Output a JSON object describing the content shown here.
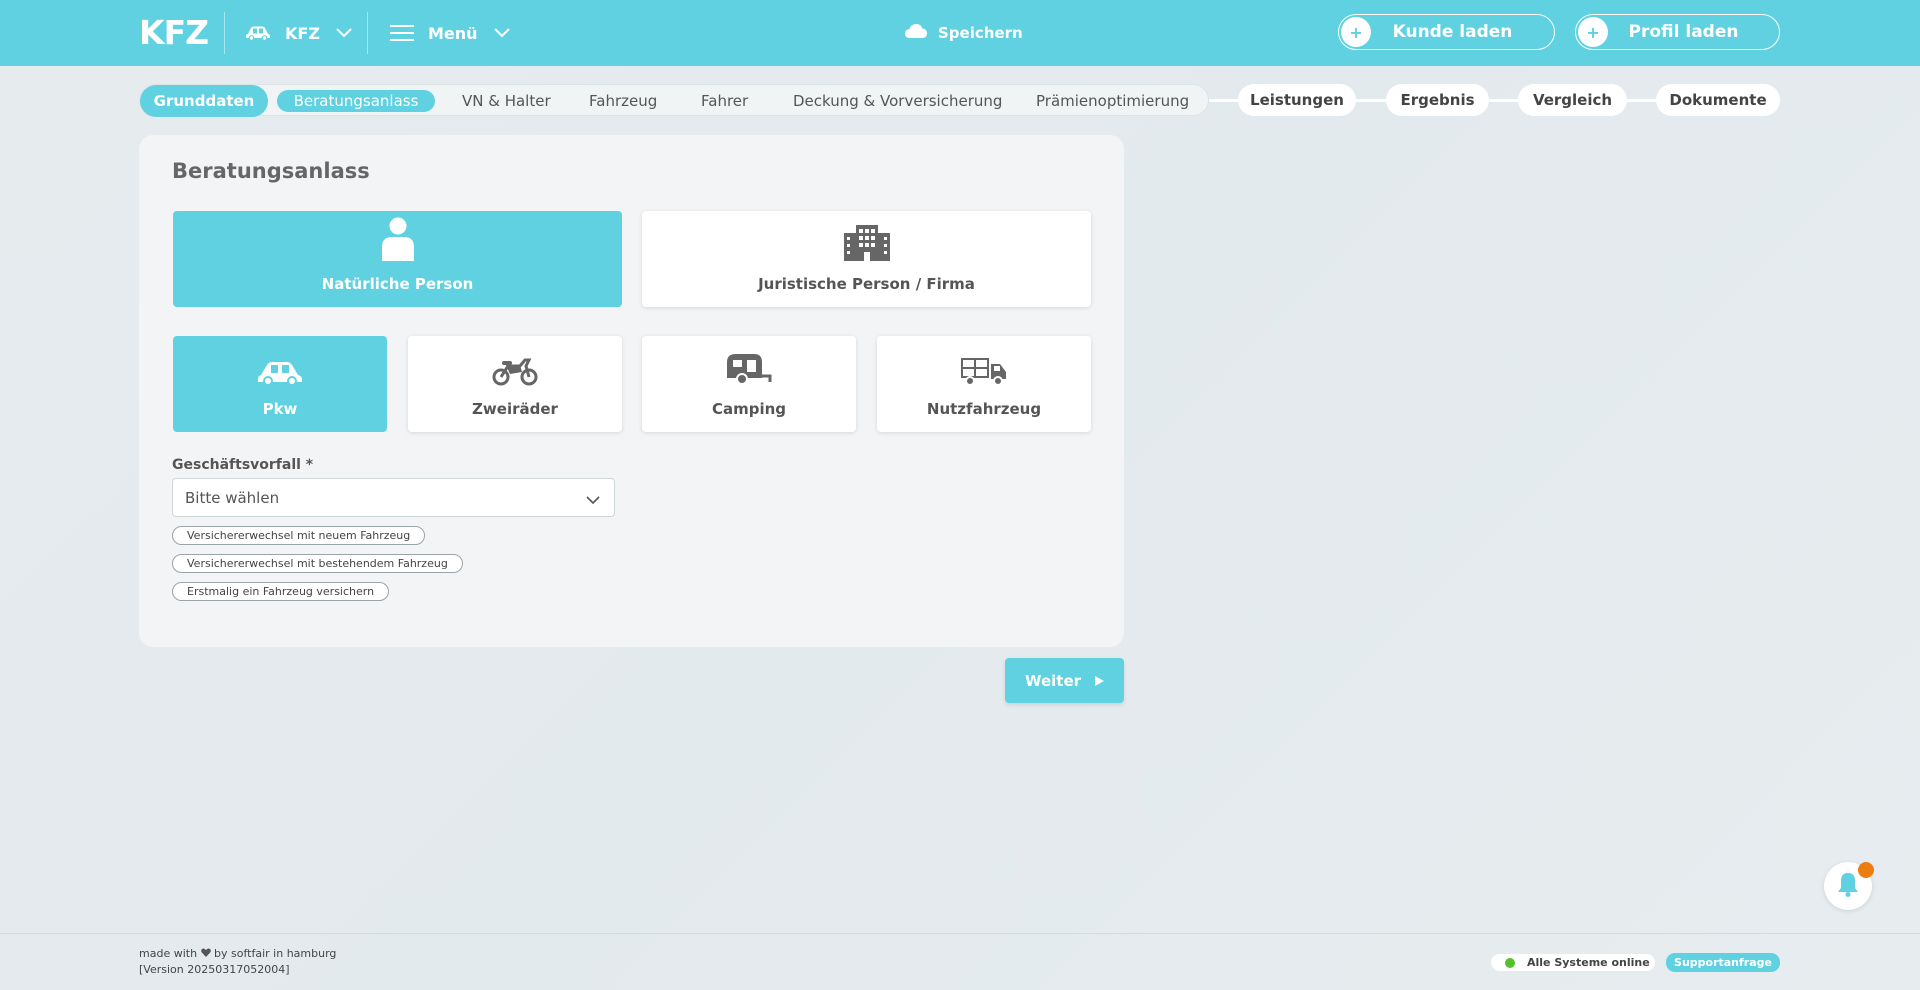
{
  "header": {
    "logo": "KFZ",
    "product_label": "KFZ",
    "menu_label": "Menü",
    "save_label": "Speichern",
    "load_customer_label": "Kunde laden",
    "load_profile_label": "Profil laden"
  },
  "steps": {
    "inner": [
      "Grunddaten",
      "Beratungsanlass",
      "VN & Halter",
      "Fahrzeug",
      "Fahrer",
      "Deckung & Vorversicherung",
      "Prämienoptimierung"
    ],
    "outer": [
      "Leistungen",
      "Ergebnis",
      "Vergleich",
      "Dokumente"
    ],
    "active": "Beratungsanlass"
  },
  "card": {
    "title": "Beratungsanlass",
    "person_types": [
      {
        "label": "Natürliche Person",
        "icon": "person-icon",
        "selected": true
      },
      {
        "label": "Juristische Person / Firma",
        "icon": "building-icon",
        "selected": false
      }
    ],
    "vehicle_types": [
      {
        "label": "Pkw",
        "icon": "car-icon",
        "selected": true
      },
      {
        "label": "Zweiräder",
        "icon": "motorcycle-icon",
        "selected": false
      },
      {
        "label": "Camping",
        "icon": "caravan-icon",
        "selected": false
      },
      {
        "label": "Nutzfahrzeug",
        "icon": "truck-icon",
        "selected": false
      }
    ],
    "business_case_label": "Geschäftsvorfall *",
    "business_case_value": "Bitte wählen",
    "suggestions": [
      "Versichererwechsel mit neuem Fahrzeug",
      "Versichererwechsel mit bestehendem Fahrzeug",
      "Erstmalig ein Fahrzeug versichern"
    ],
    "next_label": "Weiter"
  },
  "footer": {
    "made_with_pre": "made with",
    "made_with_post": "by softfair in hamburg",
    "version": "[Version 20250317052004]",
    "status": "Alle Systeme online",
    "support": "Supportanfrage"
  },
  "colors": {
    "accent": "#5fd1e0",
    "notification": "#ee7d11",
    "online": "#56c02b"
  }
}
